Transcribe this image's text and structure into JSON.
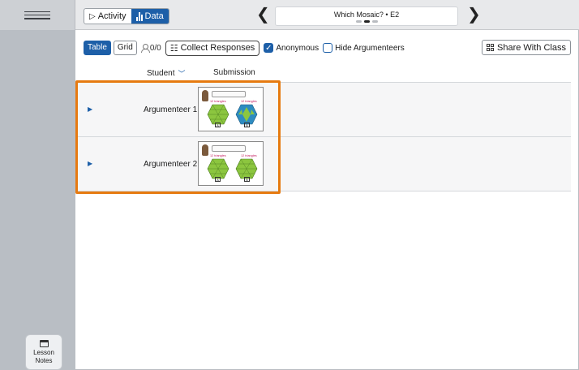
{
  "topbar": {
    "activity_label": "Activity",
    "data_label": "Data",
    "title": "Which Mosaic? • E2",
    "prev_icon": "chevron-left-icon",
    "next_icon": "chevron-right-icon"
  },
  "toolbar": {
    "table_label": "Table",
    "grid_label": "Grid",
    "responses_count": "0/0",
    "collect_label": "Collect Responses",
    "anonymous_label": "Anonymous",
    "anonymous_checked": true,
    "hide_label": "Hide Argumenteers",
    "hide_checked": false,
    "share_label": "Share With Class"
  },
  "table": {
    "columns": [
      "Student",
      "Submission"
    ],
    "rows": [
      {
        "name": "Argumenteer 1",
        "thumb": {
          "left_label": "12 triangles",
          "right_label": "12 triangles",
          "a": "A",
          "b": "B"
        }
      },
      {
        "name": "Argumenteer 2",
        "thumb": {
          "left_label": "12 triangles",
          "right_label": "12 triangles",
          "a": "A",
          "b": "B"
        }
      }
    ]
  },
  "leftrail": {
    "lesson_notes_line1": "Lesson",
    "lesson_notes_line2": "Notes"
  },
  "colors": {
    "accent": "#1d5fa8",
    "highlight": "#e67a10",
    "mosaic_green": "#8cc63f",
    "mosaic_blue": "#2e8bc0"
  }
}
